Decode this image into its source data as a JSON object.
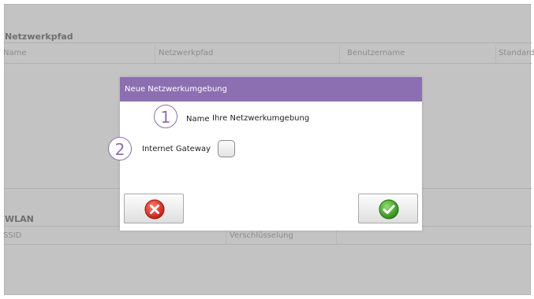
{
  "background": {
    "network_section": {
      "title": "Netzwerkpfad",
      "columns": [
        "Name",
        "Netzwerkpfad",
        "Benutzername",
        "Standard"
      ]
    },
    "wlan_section": {
      "title": "WLAN",
      "columns": [
        "SSID",
        "Verschlüsselung"
      ]
    }
  },
  "dialog": {
    "title": "Neue Netzwerkumgebung",
    "fields": {
      "name": {
        "marker": "1",
        "label": "Name",
        "value": "Ihre Netzwerkumgebung"
      },
      "internet_gateway": {
        "marker": "2",
        "label": "Internet Gateway",
        "checked": false
      }
    },
    "buttons": {
      "cancel_icon": "red-x-cancel-icon",
      "confirm_icon": "green-check-confirm-icon"
    }
  },
  "colors": {
    "dialog_header": "#8b6fb0",
    "overlay_gray": "#c3c3c3",
    "cancel_red": "#d9322a",
    "confirm_green": "#43a82b"
  }
}
